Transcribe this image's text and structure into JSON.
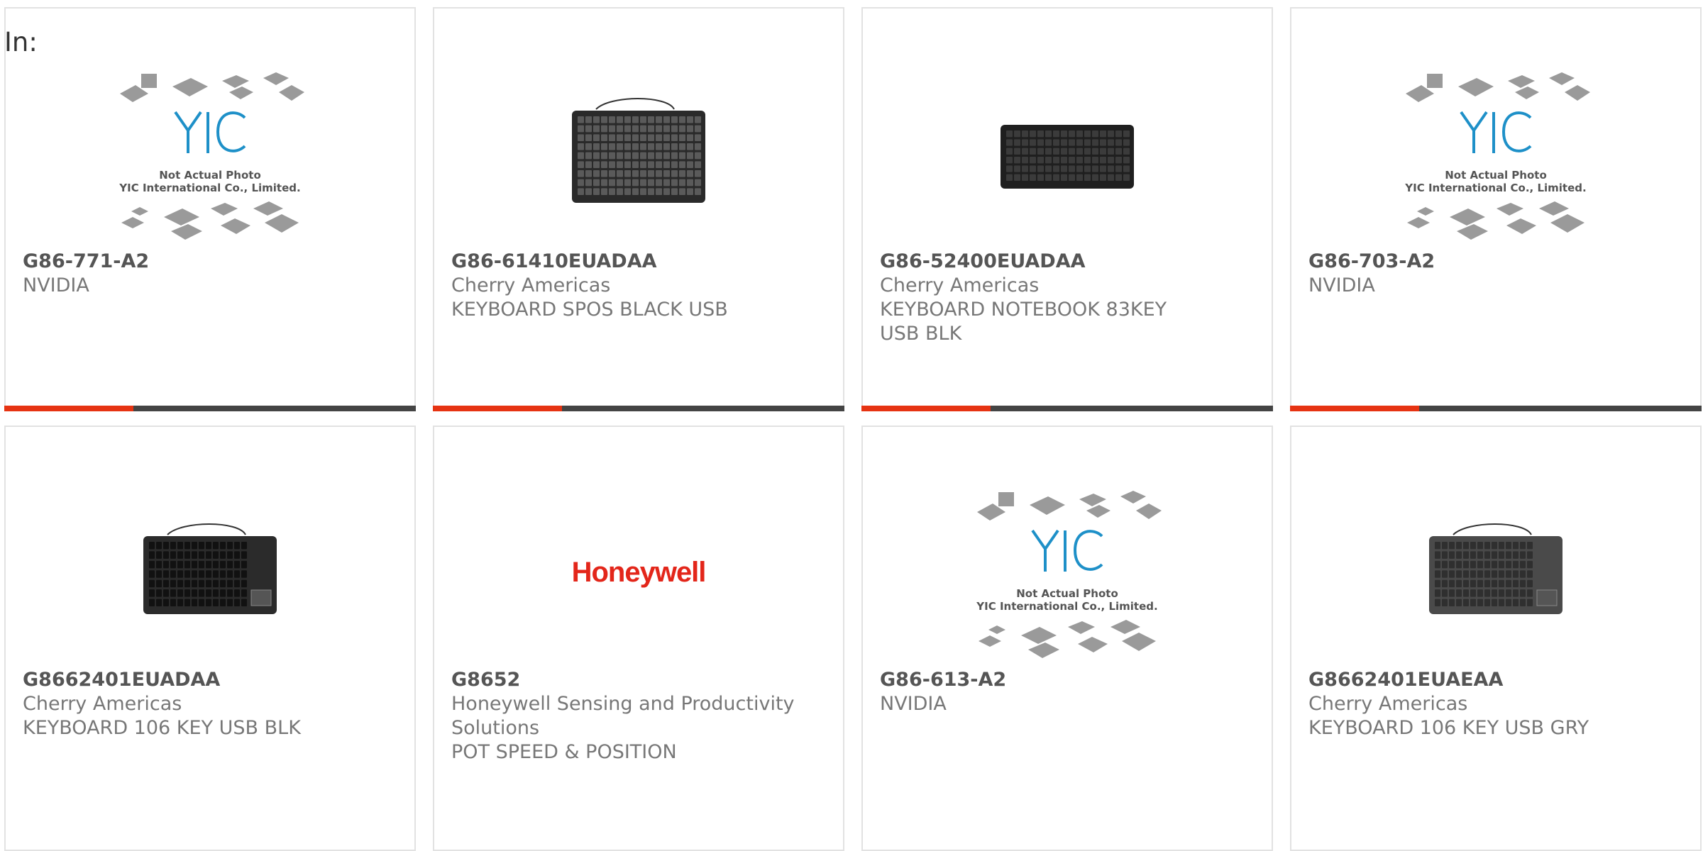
{
  "header": {
    "label": "In:"
  },
  "placeholder": {
    "line1": "Not Actual Photo",
    "line2": "YIC International Co., Limited.",
    "logo": "YIC"
  },
  "products": [
    {
      "part_number": "G86-771-A2",
      "manufacturer": "NVIDIA",
      "description": "",
      "image": "placeholder"
    },
    {
      "part_number": "G86-61410EUADAA",
      "manufacturer": "Cherry Americas",
      "description": "KEYBOARD SPOS BLACK USB",
      "image": "keyboard-pos"
    },
    {
      "part_number": "G86-52400EUADAA",
      "manufacturer": "Cherry Americas",
      "description": "KEYBOARD NOTEBOOK 83KEY USB BLK",
      "image": "keyboard-compact"
    },
    {
      "part_number": "G86-703-A2",
      "manufacturer": "NVIDIA",
      "description": "",
      "image": "placeholder"
    },
    {
      "part_number": "G8662401EUADAA",
      "manufacturer": "Cherry Americas",
      "description": "KEYBOARD 106 KEY USB BLK",
      "image": "keyboard-touchpad-black"
    },
    {
      "part_number": "G8652",
      "manufacturer": "Honeywell Sensing and Productivity Solutions",
      "description": "POT SPEED & POSITION",
      "image": "brand-logo",
      "logo_text": "Honeywell"
    },
    {
      "part_number": "G86-613-A2",
      "manufacturer": "NVIDIA",
      "description": "",
      "image": "placeholder"
    },
    {
      "part_number": "G8662401EUAEAA",
      "manufacturer": "Cherry Americas",
      "description": "KEYBOARD 106 KEY USB GRY",
      "image": "keyboard-touchpad-grey"
    }
  ],
  "colors": {
    "accent": "#e63312",
    "bar": "#444444",
    "border": "#e2e2e2",
    "logo_blue": "#1e90c8",
    "honeywell_red": "#e3261a"
  }
}
